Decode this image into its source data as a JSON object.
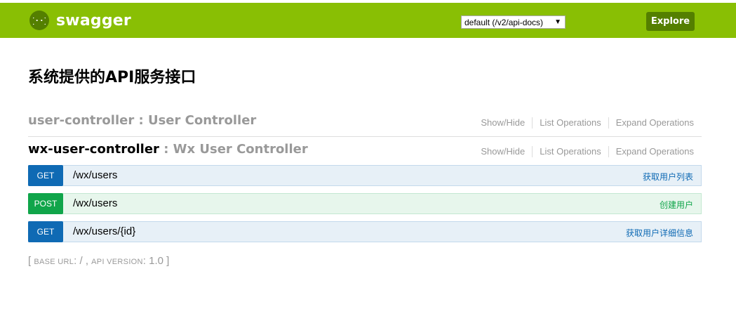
{
  "header": {
    "logo_text": "swagger",
    "spec_select_value": "default (/v2/api-docs)",
    "explore_label": "Explore",
    "colors": {
      "bar": "#89bf04",
      "dark": "#547f00"
    }
  },
  "page_title": "系统提供的API服务接口",
  "resources": [
    {
      "path": "user-controller",
      "separator": " : ",
      "description": "User Controller",
      "options": [
        "Show/Hide",
        "List Operations",
        "Expand Operations"
      ]
    },
    {
      "path": "wx-user-controller",
      "separator": " : ",
      "description": "Wx User Controller",
      "options": [
        "Show/Hide",
        "List Operations",
        "Expand Operations"
      ]
    }
  ],
  "operations": [
    {
      "method": "GET",
      "path": "/wx/users",
      "summary": "获取用户列表"
    },
    {
      "method": "POST",
      "path": "/wx/users",
      "summary": "创建用户"
    },
    {
      "method": "GET",
      "path": "/wx/users/{id}",
      "summary": "获取用户详细信息"
    }
  ],
  "footer": {
    "open_bracket": "[ ",
    "base_url_label": "BASE URL",
    "base_url_value": ": / , ",
    "api_version_label": "API VERSION",
    "api_version_value": ": 1.0",
    "close_bracket": " ]"
  }
}
